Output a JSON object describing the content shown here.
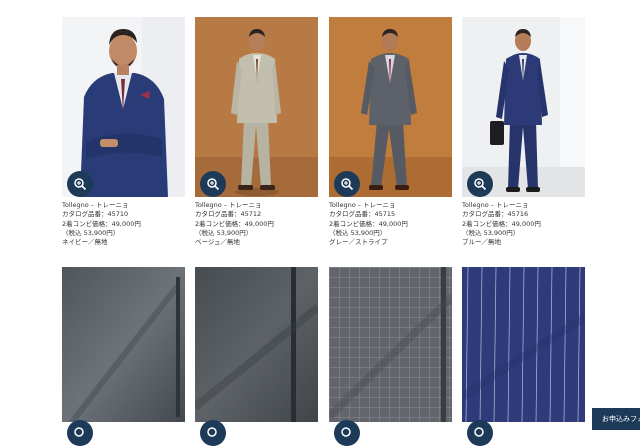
{
  "products": [
    {
      "brand": "Tollegno – トレーニョ",
      "catalog": "カタログ品番：45710",
      "price": "2着コンビ価格：49,000円",
      "tax": "（税込 53,900円）",
      "color": "ネイビー／無地",
      "photo_icon": "suit-photo",
      "zoom_icon": "zoom-in-icon"
    },
    {
      "brand": "Tollegno – トレーニョ",
      "catalog": "カタログ品番：45712",
      "price": "2着コンビ価格：49,000円",
      "tax": "（税込 53,900円）",
      "color": "ベージュ／無地",
      "photo_icon": "suit-photo",
      "zoom_icon": "zoom-in-icon"
    },
    {
      "brand": "Tollegno – トレーニョ",
      "catalog": "カタログ品番：45715",
      "price": "2着コンビ価格：49,000円",
      "tax": "（税込 53,900円）",
      "color": "グレー／ストライプ",
      "photo_icon": "suit-photo",
      "zoom_icon": "zoom-in-icon"
    },
    {
      "brand": "Tollegno – トレーニョ",
      "catalog": "カタログ品番：45716",
      "price": "2着コンビ価格：49,000円",
      "tax": "（税込 53,900円）",
      "color": "ブルー／無地",
      "photo_icon": "suit-photo",
      "zoom_icon": "zoom-in-icon"
    }
  ],
  "fabrics": [
    {
      "icon": "fabric-swatch",
      "zoom_icon": "zoom-in-icon"
    },
    {
      "icon": "fabric-swatch",
      "zoom_icon": "zoom-in-icon"
    },
    {
      "icon": "fabric-swatch",
      "zoom_icon": "zoom-in-icon"
    },
    {
      "icon": "fabric-swatch",
      "zoom_icon": "zoom-in-icon"
    }
  ],
  "apply_button": "お申込みフォーム",
  "colors": {
    "accent": "#1d3a59",
    "text": "#333333"
  }
}
